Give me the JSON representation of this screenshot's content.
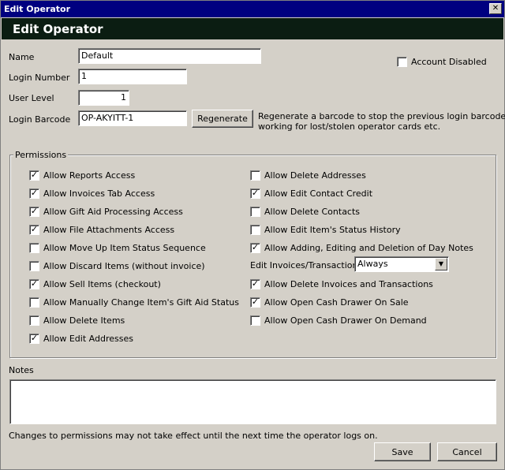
{
  "window": {
    "title": "Edit Operator",
    "close_glyph": "✕"
  },
  "header": {
    "title": "Edit Operator"
  },
  "form": {
    "name_label": "Name",
    "name_value": "Default",
    "login_number_label": "Login Number",
    "login_number_value": "1",
    "user_level_label": "User Level",
    "user_level_value": "1",
    "login_barcode_label": "Login Barcode",
    "login_barcode_value": "OP-AKYITT-1",
    "regenerate_label": "Regenerate",
    "regenerate_hint_line1": "Regenerate a barcode to stop the previous login barcode from",
    "regenerate_hint_line2": "working for lost/stolen operator cards etc.",
    "account_disabled_label": "Account Disabled",
    "account_disabled_checked": false
  },
  "permissions": {
    "title": "Permissions",
    "left": [
      {
        "label": "Allow Reports Access",
        "checked": true
      },
      {
        "label": "Allow Invoices Tab Access",
        "checked": true
      },
      {
        "label": "Allow Gift Aid Processing Access",
        "checked": true
      },
      {
        "label": "Allow File Attachments Access",
        "checked": true
      },
      {
        "label": "Allow Move Up Item Status Sequence",
        "checked": false
      },
      {
        "label": "Allow Discard Items (without invoice)",
        "checked": false
      },
      {
        "label": "Allow Sell Items (checkout)",
        "checked": true
      },
      {
        "label": "Allow Manually Change Item's Gift Aid Status",
        "checked": false
      },
      {
        "label": "Allow Delete Items",
        "checked": false
      },
      {
        "label": "Allow Edit Addresses",
        "checked": true
      }
    ],
    "right": [
      {
        "label": "Allow Delete Addresses",
        "checked": false
      },
      {
        "label": "Allow Edit Contact Credit",
        "checked": true
      },
      {
        "label": "Allow Delete Contacts",
        "checked": false
      },
      {
        "label": "Allow Edit Item's Status History",
        "checked": false
      },
      {
        "label": "Allow Adding, Editing and Deletion of Day Notes",
        "checked": true
      }
    ],
    "edit_invoices_label": "Edit Invoices/Transactions",
    "edit_invoices_value": "Always",
    "right_lower": [
      {
        "label": "Allow Delete Invoices and Transactions",
        "checked": true
      },
      {
        "label": "Allow Open Cash Drawer On Sale",
        "checked": true
      },
      {
        "label": "Allow Open Cash Drawer On Demand",
        "checked": false
      }
    ]
  },
  "notes": {
    "label": "Notes",
    "value": ""
  },
  "footer": {
    "message": "Changes to permissions may not take effect until the next time the operator logs on.",
    "save_label": "Save",
    "cancel_label": "Cancel"
  }
}
